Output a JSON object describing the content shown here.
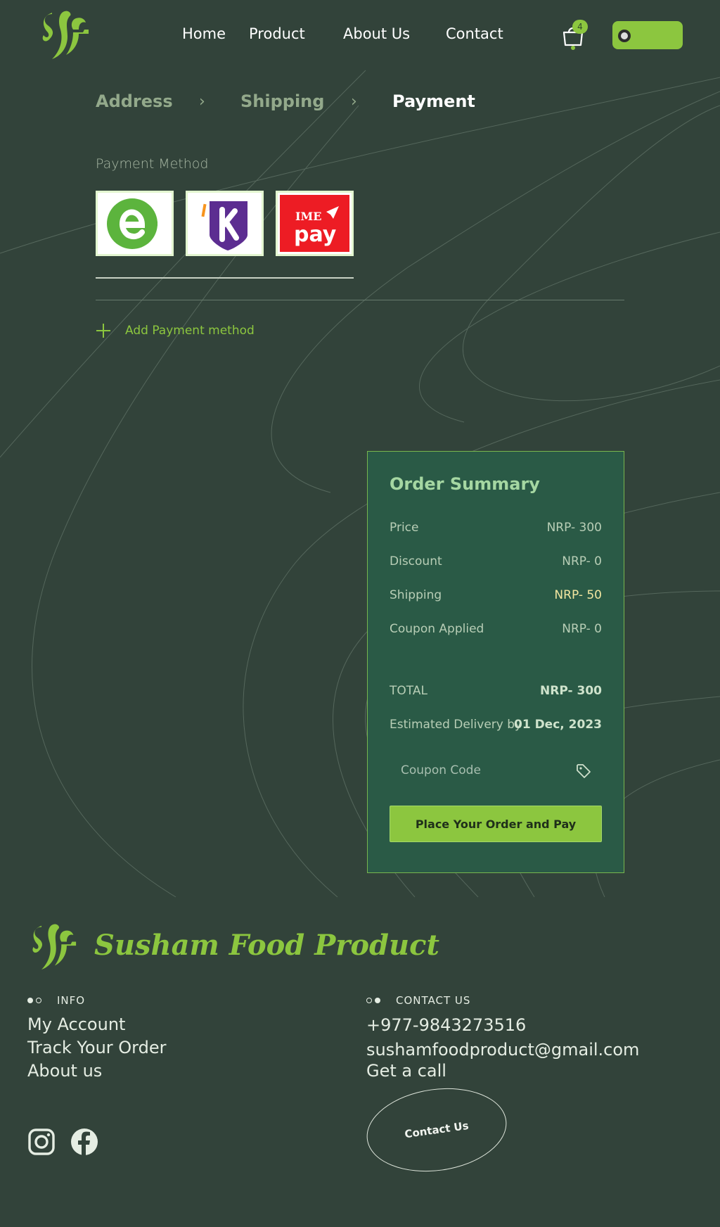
{
  "nav": {
    "home": "Home",
    "product": "Product",
    "about": "About Us",
    "contact": "Contact",
    "cart_count": "4"
  },
  "steps": {
    "address": "Address",
    "shipping": "Shipping",
    "payment": "Payment"
  },
  "payment": {
    "label": "Payment Method",
    "methods": [
      "eSewa",
      "Khalti",
      "IME pay"
    ],
    "ime_top": "IME",
    "ime_bottom": "pay",
    "add_label": "Add Payment method"
  },
  "summary": {
    "title": "Order Summary",
    "rows": [
      {
        "label": "Price",
        "value": "NRP- 300"
      },
      {
        "label": "Discount",
        "value": "NRP- 0"
      },
      {
        "label": "Shipping",
        "value": "NRP- 50"
      },
      {
        "label": "Coupon Applied",
        "value": "NRP- 0"
      }
    ],
    "total_label": "TOTAL",
    "total_value": "NRP- 300",
    "delivery_label": "Estimated Delivery by",
    "delivery_value": "01 Dec, 2023",
    "coupon_placeholder": "Coupon Code",
    "cta": "Place Your Order and Pay"
  },
  "footer": {
    "brand": "Susham Food Product",
    "info_heading": "INFO",
    "info_links": [
      "My Account",
      "Track Your Order",
      "About us"
    ],
    "contact_heading": "CONTACT US",
    "phone": "+977-9843273516",
    "email": "sushamfoodproduct@gmail.com",
    "call": "Get a call",
    "contact_button": "Contact Us"
  },
  "colors": {
    "background": "#32433a",
    "accent": "#8cc63f",
    "summary_bg": "#2a5a46"
  }
}
